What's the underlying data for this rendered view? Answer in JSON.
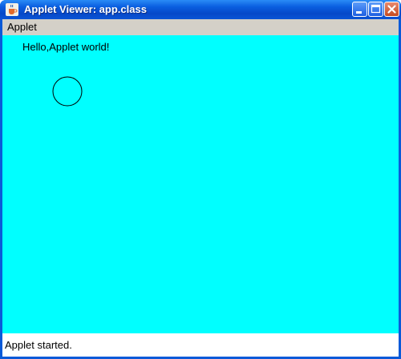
{
  "window": {
    "title": "Applet Viewer: app.class",
    "icon": "java-cup-icon",
    "buttons": [
      "minimize-icon",
      "maximize-icon",
      "close-icon"
    ]
  },
  "menubar": {
    "items": [
      {
        "label": "Applet"
      }
    ]
  },
  "applet": {
    "background_color": "#00ffff",
    "greeting": "Hello,Applet world!",
    "shape": "circle-outline"
  },
  "statusbar": {
    "text": "Applet started."
  }
}
